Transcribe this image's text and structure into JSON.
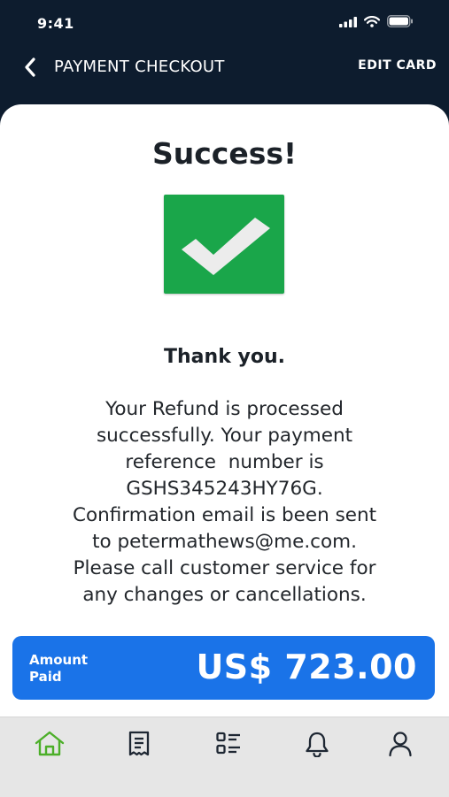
{
  "status_bar": {
    "time": "9:41"
  },
  "nav": {
    "title": "PAYMENT CHECKOUT",
    "edit_card": "EDIT CARD"
  },
  "main": {
    "title": "Success!",
    "thanks": "Thank you.",
    "message_lines": [
      "Your Refund is processed",
      "successfully. Your payment",
      "reference  number is",
      "GSHS345243HY76G.",
      "Confirmation email is been sent",
      "to petermathews@me.com.",
      "Please call customer service for",
      "any changes or cancellations."
    ]
  },
  "amount": {
    "label_line1": "Amount",
    "label_line2": "Paid",
    "value": "US$ 723.00"
  },
  "tabs": [
    {
      "icon": "home-icon",
      "active": true
    },
    {
      "icon": "receipt-icon",
      "active": false
    },
    {
      "icon": "list-icon",
      "active": false
    },
    {
      "icon": "bell-icon",
      "active": false
    },
    {
      "icon": "user-icon",
      "active": false
    }
  ],
  "colors": {
    "header_bg": "#0d1c2e",
    "success_green": "#1aa64a",
    "accent_blue": "#1a73e8",
    "active_tab": "#4caf29",
    "tab_icon": "#1e2733"
  }
}
